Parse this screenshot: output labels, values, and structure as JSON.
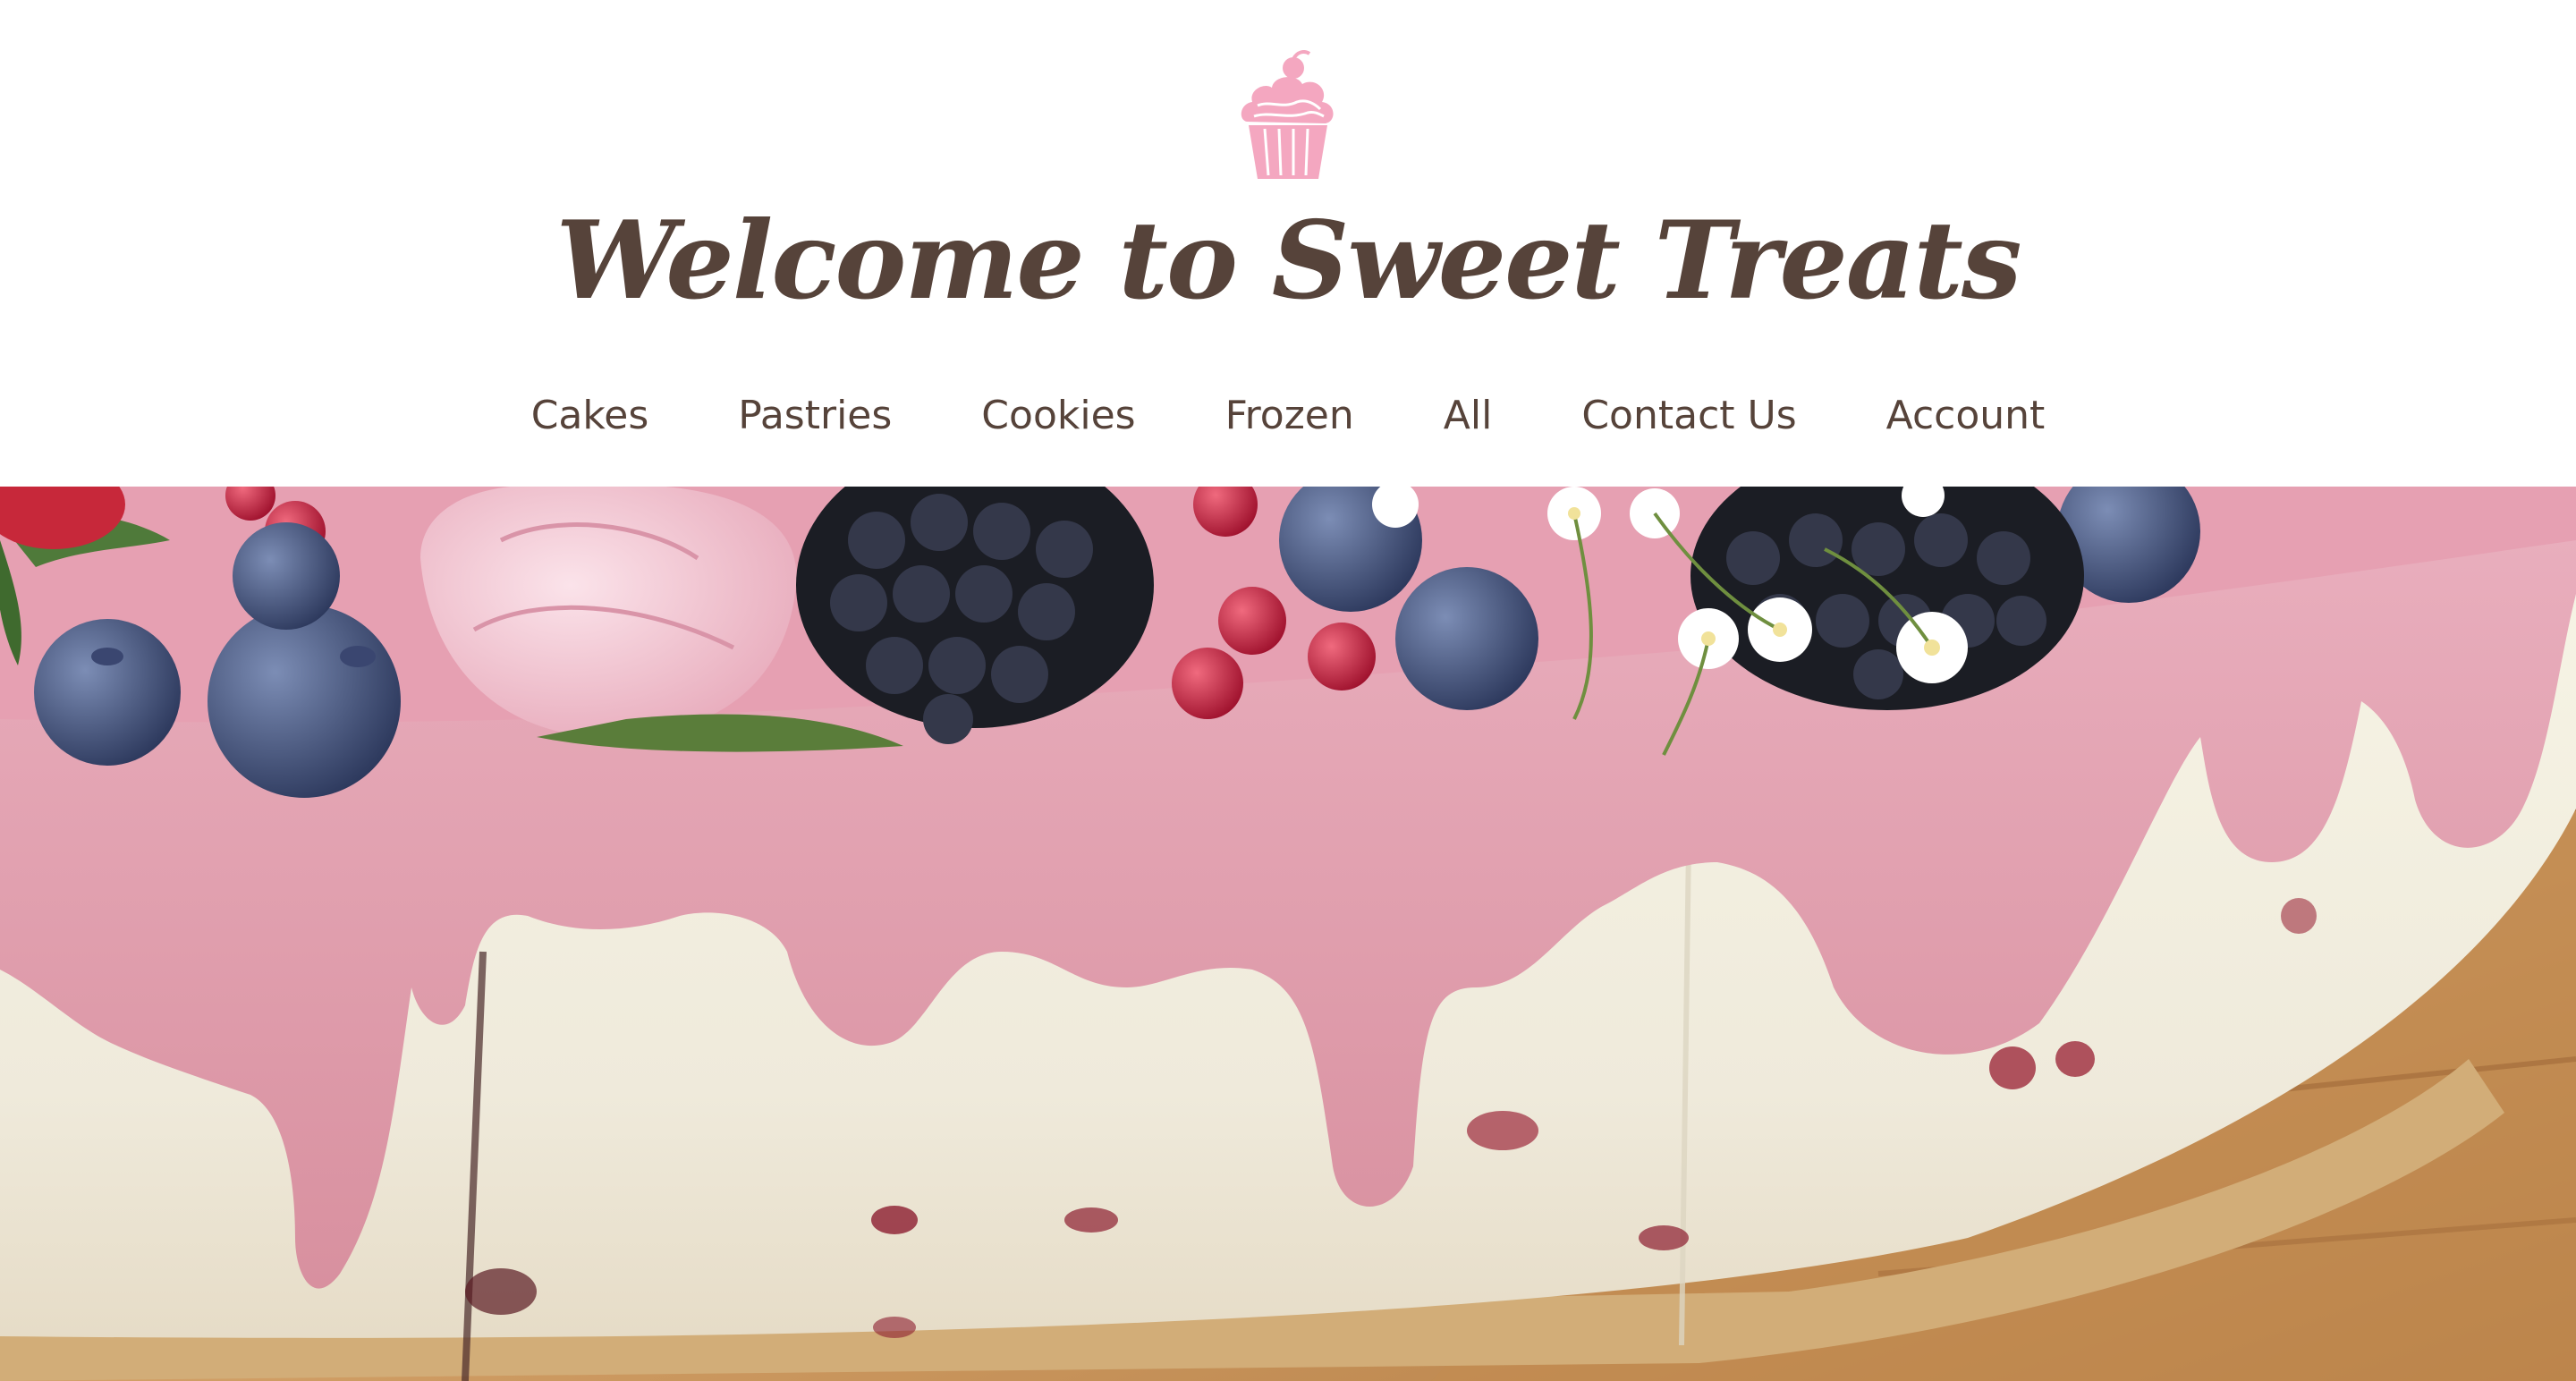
{
  "header": {
    "title": "Welcome to Sweet Treats",
    "logo_icon": "cupcake-icon",
    "logo_color": "#f4a7c0",
    "text_color": "#56433a"
  },
  "nav": {
    "items": [
      {
        "label": "Cakes"
      },
      {
        "label": "Pastries"
      },
      {
        "label": "Cookies"
      },
      {
        "label": "Frozen"
      },
      {
        "label": "All"
      },
      {
        "label": "Contact Us"
      },
      {
        "label": "Account"
      }
    ]
  },
  "hero": {
    "icon": "cake-photo",
    "colors": {
      "glaze": "#e5a3b3",
      "cream": "#f3f0df",
      "wood": "#c8955a",
      "berry": "#2b2f3d"
    }
  }
}
